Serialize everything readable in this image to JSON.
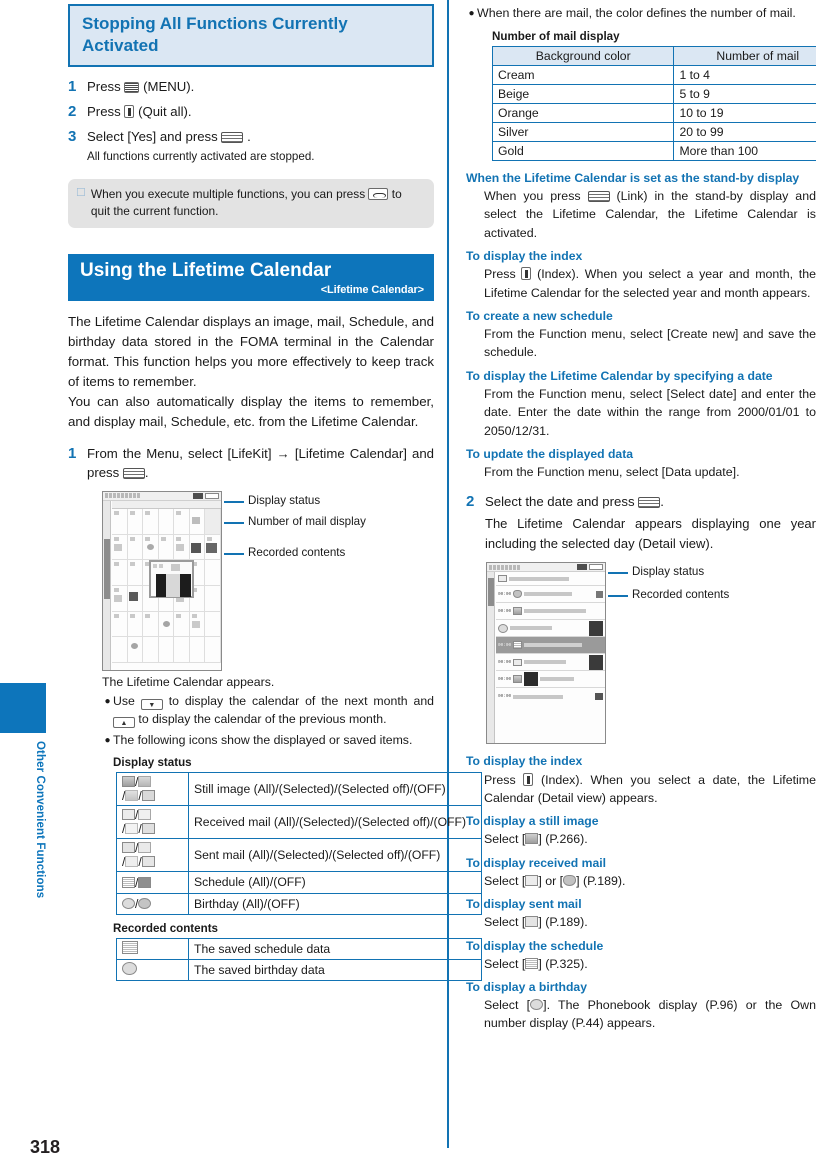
{
  "page": {
    "number": "318",
    "side_tab_label": "Other Convenient Functions"
  },
  "left_column": {
    "section1": {
      "heading": "Stopping All Functions Currently Activated",
      "steps": [
        {
          "num": "1",
          "before": "Press",
          "icon": "menu-key-icon",
          "after": "(MENU)."
        },
        {
          "num": "2",
          "before": "Press",
          "icon": "i-key-icon",
          "after": "(Quit all)."
        },
        {
          "num": "3",
          "before": "Select [Yes] and press",
          "icon": "select-key-icon",
          "after": ".",
          "note": "All functions currently activated are stopped."
        }
      ],
      "tip": {
        "text_before": "When you execute multiple functions, you can press",
        "icon": "end-key-icon",
        "text_after": "to quit the current function."
      }
    },
    "section2": {
      "heading": "Using the Lifetime Calendar",
      "subheading": "<Lifetime Calendar>",
      "intro_p1": "The Lifetime Calendar displays an image, mail, Schedule, and birthday data stored in the FOMA terminal in the Calendar format. This function helps you more effectively to keep track of items to remember.",
      "intro_p2": "You can also automatically display the items to remember, and display mail, Schedule, etc. from the Lifetime Calendar.",
      "step1": {
        "num": "1",
        "text_before": "From the Menu, select [LifeKit] → [Lifetime Calendar] and press",
        "icon": "select-key-icon",
        "text_after": "."
      },
      "screenshot_callouts": [
        "Display status",
        "Number of mail display",
        "Recorded contents"
      ],
      "after_shot_text": "The Lifetime Calendar appears.",
      "bullets": [
        {
          "before": "Use",
          "icon1": "down-key-icon",
          "mid": "to display the calendar of the next month and",
          "icon2": "up-key-icon",
          "after": "to display the calendar of the previous month."
        },
        {
          "text": "The following icons show the displayed or saved items."
        }
      ],
      "display_status": {
        "caption": "Display status",
        "rows": [
          {
            "icon": "still-image-status-icon",
            "label": "Still image (All)/(Selected)/(Selected off)/(OFF)"
          },
          {
            "icon": "received-mail-status-icon",
            "label": "Received mail (All)/(Selected)/(Selected off)/(OFF)"
          },
          {
            "icon": "sent-mail-status-icon",
            "label": "Sent mail (All)/(Selected)/(Selected off)/(OFF)"
          },
          {
            "icon": "schedule-status-icon",
            "label": "Schedule (All)/(OFF)"
          },
          {
            "icon": "birthday-status-icon",
            "label": "Birthday (All)/(OFF)"
          }
        ]
      },
      "recorded_contents": {
        "caption": "Recorded contents",
        "rows": [
          {
            "icon": "schedule-data-icon",
            "label": "The saved schedule data"
          },
          {
            "icon": "birthday-data-icon",
            "label": "The saved birthday data"
          }
        ]
      }
    }
  },
  "right_column": {
    "mail_bullet": "When there are mail, the color defines the number of mail.",
    "mail_table": {
      "caption": "Number of mail display",
      "headers": [
        "Background color",
        "Number of mail"
      ],
      "rows": [
        [
          "Cream",
          "1 to 4"
        ],
        [
          "Beige",
          "5 to 9"
        ],
        [
          "Orange",
          "10 to 19"
        ],
        [
          "Silver",
          "20 to 99"
        ],
        [
          "Gold",
          "More than 100"
        ]
      ]
    },
    "subsections": [
      {
        "title": "When the Lifetime Calendar is set as the stand-by display",
        "before": "When you press",
        "icon": "select-key-icon",
        "after": "(Link) in the stand-by display and select the Lifetime Calendar, the Lifetime Calendar is activated."
      },
      {
        "title": "To display the index",
        "before": "Press",
        "icon": "i-key-icon",
        "after": "(Index). When you select a year and month, the Lifetime Calendar for the selected year and month appears."
      },
      {
        "title": "To create a new schedule",
        "body": "From the Function menu, select [Create new] and save the schedule."
      },
      {
        "title": "To display the Lifetime Calendar by specifying a date",
        "body": "From the Function menu, select [Select date] and enter the date. Enter the date within the range from 2000/01/01 to 2050/12/31."
      },
      {
        "title": "To update the displayed data",
        "body": "From the Function menu, select [Data update]."
      }
    ],
    "step2": {
      "num": "2",
      "text_before": "Select the date and press",
      "icon": "select-key-icon",
      "text_after": ".",
      "note": "The Lifetime Calendar appears displaying one year including the selected day (Detail view)."
    },
    "screenshot_callouts": [
      "Display status",
      "Recorded contents"
    ],
    "subsections2": [
      {
        "title": "To display the index",
        "before": "Press",
        "icon": "i-key-icon",
        "after": "(Index). When you select a date, the Lifetime Calendar (Detail view) appears."
      },
      {
        "title": "To display a still image",
        "before": "Select [",
        "icon": "still-image-icon",
        "after": "] (P.266)."
      },
      {
        "title": "To display received mail",
        "before": "Select [",
        "icon": "received-mail-icon",
        "mid": "] or [",
        "icon2": "received-mail-alt-icon",
        "after": "] (P.189)."
      },
      {
        "title": "To display sent mail",
        "before": "Select [",
        "icon": "sent-mail-icon",
        "after": "] (P.189)."
      },
      {
        "title": "To display the schedule",
        "before": "Select [",
        "icon": "schedule-icon",
        "after": "] (P.325)."
      },
      {
        "title": "To display a birthday",
        "before": "Select [",
        "icon": "birthday-icon",
        "after": "]. The Phonebook display (P.96) or the Own number display (P.44) appears."
      }
    ]
  },
  "colors": {
    "accent_blue": "#1273b3",
    "bar_blue": "#0d75bb",
    "heading_bg": "#dbe7f3",
    "tip_bg": "#e3e3e3"
  }
}
